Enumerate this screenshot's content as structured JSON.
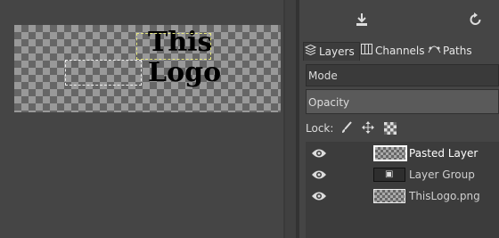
{
  "canvas": {
    "image_text_line1": "This",
    "image_text_line2": "Logo"
  },
  "panel": {
    "top_icons": [
      "export-icon",
      "reset-icon"
    ],
    "tabs": [
      {
        "label": "Layers",
        "icon": "layers-icon",
        "active": true
      },
      {
        "label": "Channels",
        "icon": "channels-icon",
        "active": false
      },
      {
        "label": "Paths",
        "icon": "paths-icon",
        "active": false
      }
    ],
    "mode_label": "Mode",
    "opacity_label": "Opacity",
    "lock_label": "Lock:",
    "lock_icons": [
      "lock-pixels-icon",
      "lock-position-icon",
      "lock-alpha-icon"
    ]
  },
  "layers": [
    {
      "name": "Pasted Layer",
      "visible": true,
      "selected": true,
      "type": "layer"
    },
    {
      "name": "Layer Group",
      "visible": true,
      "selected": false,
      "type": "group"
    },
    {
      "name": "ThisLogo.png",
      "visible": true,
      "selected": false,
      "type": "layer"
    }
  ]
}
